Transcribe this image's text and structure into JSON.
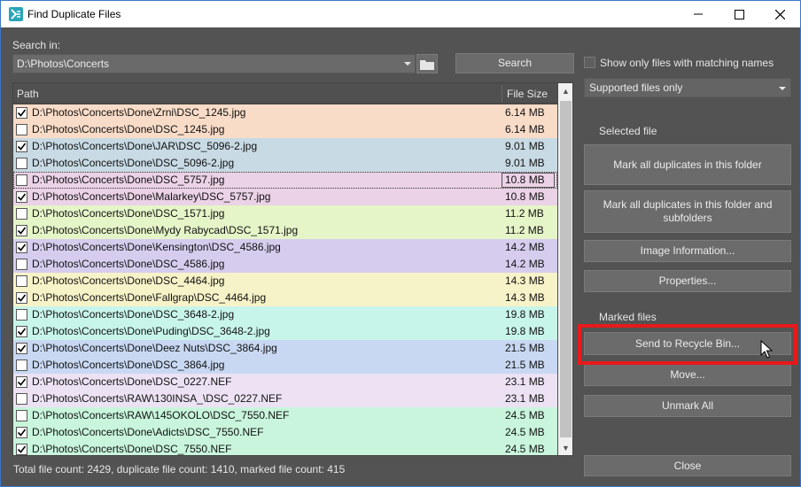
{
  "window": {
    "title": "Find Duplicate Files"
  },
  "search": {
    "label": "Search in:",
    "path_value": "D:\\Photos\\Concerts",
    "search_button": "Search"
  },
  "options": {
    "show_matching_names_label": "Show only files with matching names",
    "filter_value": "Supported files only"
  },
  "list": {
    "headers": {
      "path": "Path",
      "size": "File Size"
    },
    "rows": [
      {
        "checked": true,
        "path": "D:\\Photos\\Concerts\\Done\\Zrni\\DSC_1245.jpg",
        "size": "6.14 MB",
        "color": "#f9dcc8"
      },
      {
        "checked": false,
        "path": "D:\\Photos\\Concerts\\Done\\DSC_1245.jpg",
        "size": "6.14 MB",
        "color": "#f9dcc8"
      },
      {
        "checked": true,
        "path": "D:\\Photos\\Concerts\\Done\\JAR\\DSC_5096-2.jpg",
        "size": "9.01 MB",
        "color": "#c8dae4"
      },
      {
        "checked": false,
        "path": "D:\\Photos\\Concerts\\Done\\DSC_5096-2.jpg",
        "size": "9.01 MB",
        "color": "#c8dae4"
      },
      {
        "checked": false,
        "path": "D:\\Photos\\Concerts\\Done\\DSC_5757.jpg",
        "size": "10.8 MB",
        "color": "#ebd2e6",
        "focused": true
      },
      {
        "checked": true,
        "path": "D:\\Photos\\Concerts\\Done\\Malarkey\\DSC_5757.jpg",
        "size": "10.8 MB",
        "color": "#ebd2e6"
      },
      {
        "checked": false,
        "path": "D:\\Photos\\Concerts\\Done\\DSC_1571.jpg",
        "size": "11.2 MB",
        "color": "#e6f5c8"
      },
      {
        "checked": true,
        "path": "D:\\Photos\\Concerts\\Done\\Mydy Rabycad\\DSC_1571.jpg",
        "size": "11.2 MB",
        "color": "#e6f5c8"
      },
      {
        "checked": true,
        "path": "D:\\Photos\\Concerts\\Done\\Kensington\\DSC_4586.jpg",
        "size": "14.2 MB",
        "color": "#d6cdee"
      },
      {
        "checked": false,
        "path": "D:\\Photos\\Concerts\\Done\\DSC_4586.jpg",
        "size": "14.2 MB",
        "color": "#d6cdee"
      },
      {
        "checked": false,
        "path": "D:\\Photos\\Concerts\\Done\\DSC_4464.jpg",
        "size": "14.3 MB",
        "color": "#f7f3c8"
      },
      {
        "checked": true,
        "path": "D:\\Photos\\Concerts\\Done\\Fallgrap\\DSC_4464.jpg",
        "size": "14.3 MB",
        "color": "#f7f3c8"
      },
      {
        "checked": false,
        "path": "D:\\Photos\\Concerts\\Done\\DSC_3648-2.jpg",
        "size": "19.8 MB",
        "color": "#c8f5ea"
      },
      {
        "checked": true,
        "path": "D:\\Photos\\Concerts\\Done\\Puding\\DSC_3648-2.jpg",
        "size": "19.8 MB",
        "color": "#c8f5ea"
      },
      {
        "checked": true,
        "path": "D:\\Photos\\Concerts\\Done\\Deez Nuts\\DSC_3864.jpg",
        "size": "21.5 MB",
        "color": "#c8d8f2"
      },
      {
        "checked": false,
        "path": "D:\\Photos\\Concerts\\Done\\DSC_3864.jpg",
        "size": "21.5 MB",
        "color": "#c8d8f2"
      },
      {
        "checked": true,
        "path": "D:\\Photos\\Concerts\\Done\\DSC_0227.NEF",
        "size": "23.1 MB",
        "color": "#ece2f4"
      },
      {
        "checked": false,
        "path": "D:\\Photos\\Concerts\\RAW\\130INSA_\\DSC_0227.NEF",
        "size": "23.1 MB",
        "color": "#ece2f4"
      },
      {
        "checked": false,
        "path": "D:\\Photos\\Concerts\\RAW\\145OKOLO\\DSC_7550.NEF",
        "size": "24.5 MB",
        "color": "#c8f5dc"
      },
      {
        "checked": true,
        "path": "D:\\Photos\\Concerts\\Done\\Adicts\\DSC_7550.NEF",
        "size": "24.5 MB",
        "color": "#c8f5dc"
      },
      {
        "checked": true,
        "path": "D:\\Photos\\Concerts\\Done\\DSC_7550.NEF",
        "size": "24.5 MB",
        "color": "#c8f5dc"
      }
    ]
  },
  "status": {
    "text": "Total file count: 2429, duplicate file count: 1410, marked file count: 415"
  },
  "selected_file": {
    "heading": "Selected file",
    "mark_folder": "Mark all duplicates in this folder",
    "mark_folder_sub": "Mark all duplicates in this folder and subfolders",
    "image_info": "Image Information...",
    "properties": "Properties..."
  },
  "marked_files": {
    "heading": "Marked files",
    "recycle": "Send to Recycle Bin...",
    "move": "Move...",
    "unmark": "Unmark All"
  },
  "close_button": "Close",
  "colors": {
    "highlight": "#e8191c",
    "panel_bg": "#535353"
  }
}
